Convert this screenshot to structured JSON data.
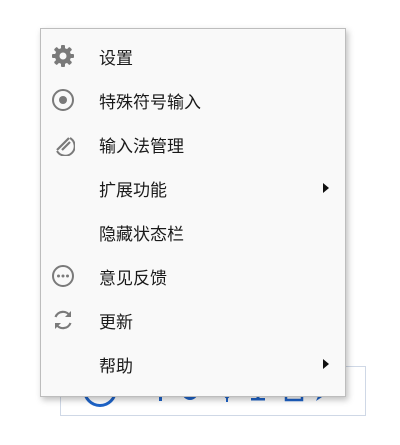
{
  "menu": {
    "items": [
      {
        "label": "设置",
        "icon": "gear-icon",
        "has_submenu": false
      },
      {
        "label": "特殊符号输入",
        "icon": "target-icon",
        "has_submenu": false
      },
      {
        "label": "输入法管理",
        "icon": "slashed-circle-icon",
        "has_submenu": false
      },
      {
        "label": "扩展功能",
        "icon": "",
        "has_submenu": true
      },
      {
        "label": "隐藏状态栏",
        "icon": "",
        "has_submenu": false
      },
      {
        "label": "意见反馈",
        "icon": "ellipsis-circle-icon",
        "has_submenu": false
      },
      {
        "label": "更新",
        "icon": "refresh-icon",
        "has_submenu": false
      },
      {
        "label": "帮助",
        "icon": "",
        "has_submenu": true
      }
    ]
  },
  "colors": {
    "menu_background": "#f9f9f9",
    "menu_border": "#bdbdbd",
    "icon_gray": "#7a7a7a",
    "toolbar_accent": "#1e63c8"
  }
}
